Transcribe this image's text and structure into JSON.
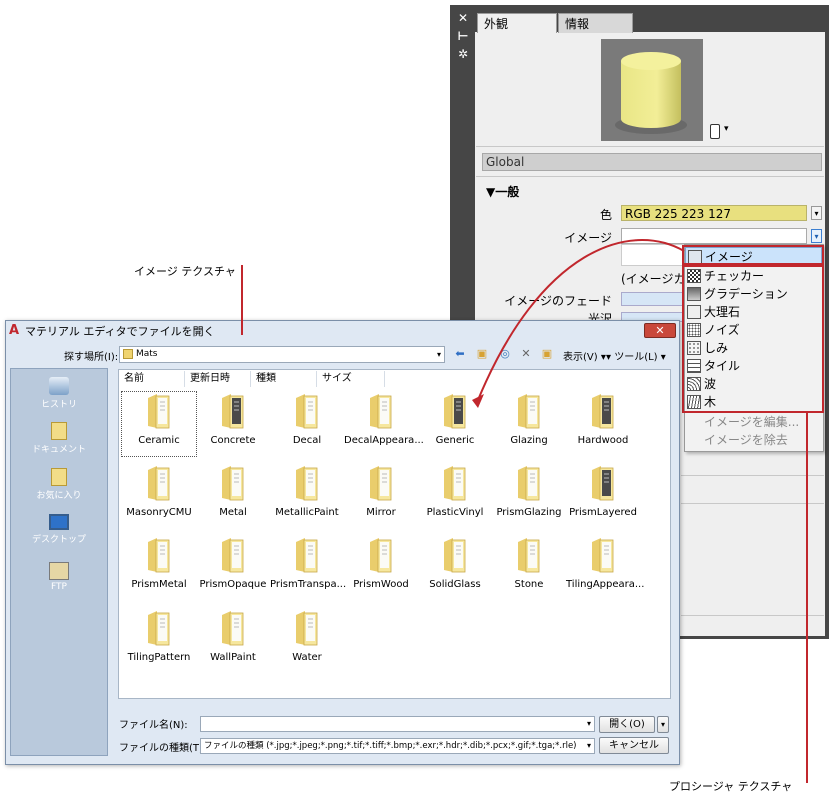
{
  "annotations": {
    "image_texture": "イメージ テクスチャ",
    "procedural_texture": "プロシージャ テクスチャ"
  },
  "material_editor": {
    "side_icons": [
      "close-icon",
      "pin-icon",
      "settings-icon"
    ],
    "tabs": [
      "外観",
      "情報"
    ],
    "preview_menu_glyph": "▾",
    "material_name": "Global",
    "section": "▼一般",
    "labels": {
      "color": "色",
      "image": "イメージ",
      "image_sub": "(イメージカ",
      "image_fade": "イメージのフェード",
      "gloss": "光沢"
    },
    "color_value": "RGB 225 223 127",
    "dropdown": {
      "selected": "イメージ",
      "items": [
        "チェッカー",
        "グラデーション",
        "大理石",
        "ノイズ",
        "しみ",
        "タイル",
        "波",
        "木"
      ],
      "disabled_items": [
        "イメージを編集...",
        "イメージを除去"
      ]
    }
  },
  "file_dialog": {
    "title": "マテリアル エディタでファイルを開く",
    "close_glyph": "✕",
    "look_in_label": "探す場所(I):",
    "look_in_value": "Mats",
    "views_label": "表示(V)",
    "tools_label": "ツール(L)",
    "places": [
      "ヒストリ",
      "ドキュメント",
      "お気に入り",
      "デスクトップ",
      "FTP"
    ],
    "columns": [
      "名前",
      "更新日時",
      "種類",
      "サイズ"
    ],
    "folders": [
      "Ceramic",
      "Concrete",
      "Decal",
      "DecalAppeara...",
      "Generic",
      "Glazing",
      "Hardwood",
      "MasonryCMU",
      "Metal",
      "MetallicPaint",
      "Mirror",
      "PlasticVinyl",
      "PrismGlazing",
      "PrismLayered",
      "PrismMetal",
      "PrismOpaque",
      "PrismTranspa...",
      "PrismWood",
      "SolidGlass",
      "Stone",
      "TilingAppeara...",
      "TilingPattern",
      "WallPaint",
      "Water"
    ],
    "file_name_label": "ファイル名(N):",
    "file_name_value": "",
    "file_type_label": "ファイルの種類(T):",
    "file_type_value": "ファイルの種類 (*.jpg;*.jpeg;*.png;*.tif;*.tiff;*.bmp;*.exr;*.hdr;*.dib;*.pcx;*.gif;*.tga;*.rle)",
    "open_button": "開く(O)",
    "cancel_button": "キャンセル"
  }
}
